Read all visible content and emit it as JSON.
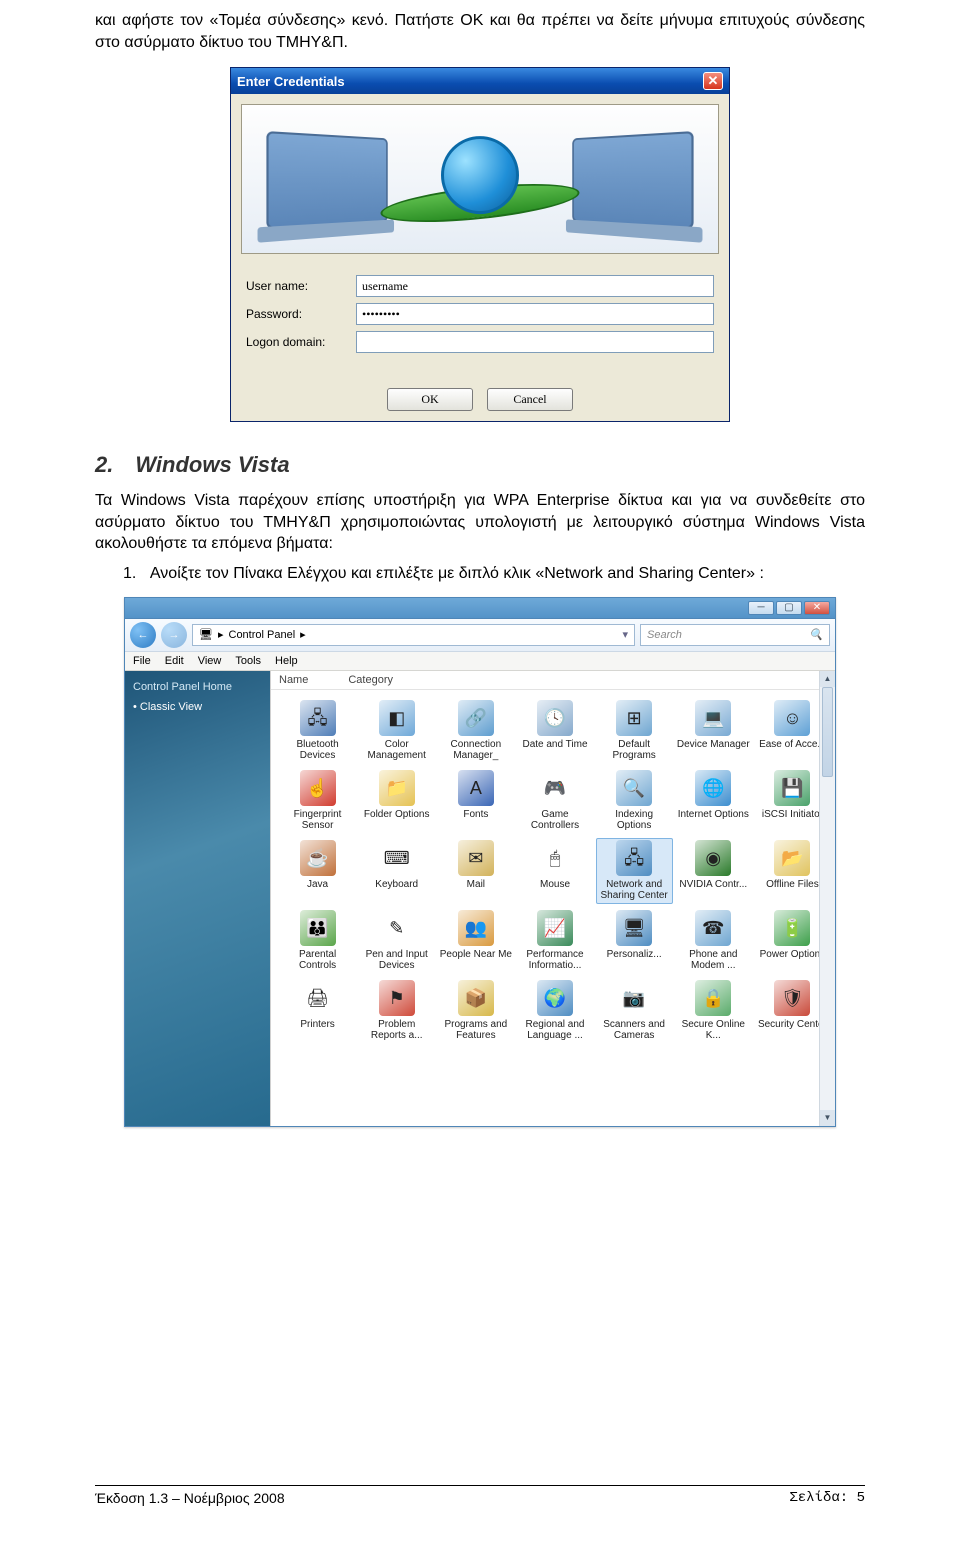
{
  "intro": "και αφήστε τον «Τομέα σύνδεσης» κενό. Πατήστε OK και θα πρέπει να δείτε μήνυμα επιτυχούς σύνδεσης στο ασύρματο δίκτυο του ΤΜΗΥ&Π.",
  "cred": {
    "title": "Enter Credentials",
    "user_label": "User name:",
    "user_value": "username",
    "pass_label": "Password:",
    "pass_value": "•••••••••",
    "domain_label": "Logon domain:",
    "domain_value": "",
    "ok": "OK",
    "cancel": "Cancel"
  },
  "section": {
    "num": "2.",
    "title": "Windows Vista",
    "body": "Τα Windows Vista παρέχουν επίσης υποστήριξη για WPA Enterprise δίκτυα και για να συνδεθείτε στο ασύρματο δίκτυο του ΤΜΗΥ&Π χρησιμοποιώντας υπολογιστή με λειτουργικό σύστημα Windows Vista ακολουθήστε τα επόμενα βήματα:",
    "step_num": "1.",
    "step_text": "Ανοίξτε τον Πίνακα Ελέγχου και επιλέξτε με διπλό κλικ «Network and Sharing Center» :"
  },
  "cp": {
    "breadcrumb": "Control Panel",
    "search_placeholder": "Search",
    "menu": [
      "File",
      "Edit",
      "View",
      "Tools",
      "Help"
    ],
    "side_head": "Control Panel Home",
    "side_item": "Classic View",
    "col_name": "Name",
    "col_cat": "Category",
    "items": [
      {
        "l": "Bluetooth Devices",
        "c": "#4f7db7",
        "g": "🖧"
      },
      {
        "l": "Color Management",
        "c": "#6ea8d8",
        "g": "◧"
      },
      {
        "l": "Connection Manager_",
        "c": "#5e9dcf",
        "g": "🔗"
      },
      {
        "l": "Date and Time",
        "c": "#85a9cc",
        "g": "🕓"
      },
      {
        "l": "Default Programs",
        "c": "#6fa6d1",
        "g": "⊞"
      },
      {
        "l": "Device Manager",
        "c": "#78a9d3",
        "g": "💻"
      },
      {
        "l": "Ease of Acce...",
        "c": "#5ea0d5",
        "g": "☺"
      },
      {
        "l": "Fingerprint Sensor",
        "c": "#d13c2f",
        "g": "☝"
      },
      {
        "l": "Folder Options",
        "c": "#e5c253",
        "g": "📁"
      },
      {
        "l": "Fonts",
        "c": "#3a66b5",
        "g": "A"
      },
      {
        "l": "Game Controllers",
        "c": "#888",
        "g": "🎮"
      },
      {
        "l": "Indexing Options",
        "c": "#6fa6d1",
        "g": "🔍"
      },
      {
        "l": "Internet Options",
        "c": "#3d8ecf",
        "g": "🌐"
      },
      {
        "l": "iSCSI Initiator",
        "c": "#4aa26a",
        "g": "💾"
      },
      {
        "l": "Java",
        "c": "#c0703a",
        "g": "☕"
      },
      {
        "l": "Keyboard",
        "c": "#999",
        "g": "⌨"
      },
      {
        "l": "Mail",
        "c": "#d2b25a",
        "g": "✉"
      },
      {
        "l": "Mouse",
        "c": "#888",
        "g": "🖱"
      },
      {
        "l": "Network and Sharing Center",
        "c": "#4f8dc2",
        "g": "🖧",
        "selected": true
      },
      {
        "l": "NVIDIA Contr...",
        "c": "#2a7a2a",
        "g": "◉"
      },
      {
        "l": "Offline Files",
        "c": "#e0c35e",
        "g": "📂"
      },
      {
        "l": "Parental Controls",
        "c": "#5aa54a",
        "g": "👪"
      },
      {
        "l": "Pen and Input Devices",
        "c": "#888",
        "g": "✎"
      },
      {
        "l": "People Near Me",
        "c": "#d99a3f",
        "g": "👥"
      },
      {
        "l": "Performance Informatio...",
        "c": "#3a8a5a",
        "g": "📈"
      },
      {
        "l": "Personaliz...",
        "c": "#4f8dc2",
        "g": "🖥"
      },
      {
        "l": "Phone and Modem ...",
        "c": "#6fa6d1",
        "g": "☎"
      },
      {
        "l": "Power Options",
        "c": "#3d9f4a",
        "g": "🔋"
      },
      {
        "l": "Printers",
        "c": "#888",
        "g": "🖨"
      },
      {
        "l": "Problem Reports a...",
        "c": "#cf4a3a",
        "g": "⚑"
      },
      {
        "l": "Programs and Features",
        "c": "#d7b84a",
        "g": "📦"
      },
      {
        "l": "Regional and Language ...",
        "c": "#4f8dc2",
        "g": "🌍"
      },
      {
        "l": "Scanners and Cameras",
        "c": "#888",
        "g": "📷"
      },
      {
        "l": "Secure Online K...",
        "c": "#5aab6a",
        "g": "🔒"
      },
      {
        "l": "Security Center",
        "c": "#c94a3a",
        "g": "🛡"
      }
    ]
  },
  "footer": {
    "left": "Έκδοση 1.3 – Νοέμβριος 2008",
    "right": "Σελίδα: 5"
  }
}
